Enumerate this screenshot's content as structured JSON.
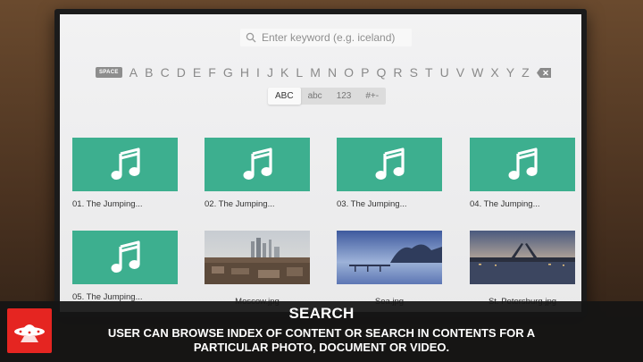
{
  "search": {
    "placeholder": "Enter keyword (e.g. iceland)"
  },
  "keyboard": {
    "space_label": "SPACE",
    "letters": [
      "A",
      "B",
      "C",
      "D",
      "E",
      "F",
      "G",
      "H",
      "I",
      "J",
      "K",
      "L",
      "M",
      "N",
      "O",
      "P",
      "Q",
      "R",
      "S",
      "T",
      "U",
      "V",
      "W",
      "X",
      "Y",
      "Z"
    ],
    "modes": [
      "ABC",
      "abc",
      "123",
      "#+-"
    ],
    "active_mode": "ABC"
  },
  "items": [
    {
      "caption": "01. The Jumping...",
      "type": "audio"
    },
    {
      "caption": "02. The Jumping...",
      "type": "audio"
    },
    {
      "caption": "03. The Jumping...",
      "type": "audio"
    },
    {
      "caption": "04. The Jumping...",
      "type": "audio"
    },
    {
      "caption": "05. The Jumping...",
      "type": "audio"
    },
    {
      "caption": "Moscow.jpg",
      "type": "photo"
    },
    {
      "caption": "Sea.jpg",
      "type": "photo"
    },
    {
      "caption": "St. Petersburg.jpg",
      "type": "photo"
    }
  ],
  "banner": {
    "title": "SEARCH",
    "description": "USER CAN BROWSE INDEX OF CONTENT OR SEARCH IN CONTENTS FOR A PARTICULAR PHOTO, DOCUMENT OR VIDEO."
  },
  "colors": {
    "tile_accent": "#3daf8f",
    "logo_red": "#e52521",
    "banner_bg": "#141414"
  }
}
